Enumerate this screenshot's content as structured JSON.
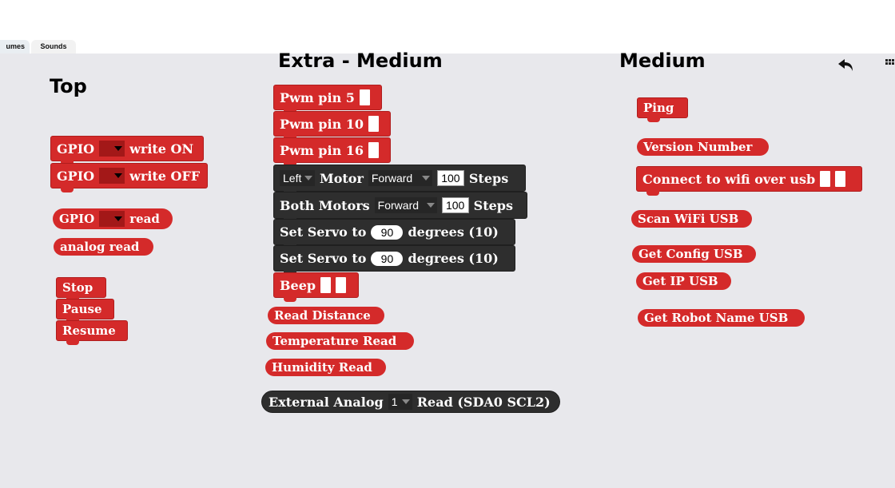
{
  "tabs": {
    "costumes": "umes",
    "sounds": "Sounds"
  },
  "headings": {
    "top": "Top",
    "extra_medium": "Extra - Medium",
    "medium": "Medium"
  },
  "top": {
    "gpio": "GPIO",
    "write_on": "write ON",
    "write_off": "write OFF",
    "read": "read",
    "analog_read": "analog read",
    "stop": "Stop",
    "pause": "Pause",
    "resume": "Resume"
  },
  "extra": {
    "pwm5": "Pwm pin 5",
    "pwm10": "Pwm pin 10",
    "pwm16": "Pwm pin 16",
    "left": "Left",
    "motor": "Motor",
    "forward": "Forward",
    "steps_value": "100",
    "steps": "Steps",
    "both_motors": "Both Motors",
    "set_servo": "Set Servo to",
    "servo_value": "90",
    "degrees": "degrees (10)",
    "beep": "Beep",
    "read_distance": "Read Distance",
    "temperature_read": "Temperature Read",
    "humidity_read": "Humidity Read",
    "external_analog": "External Analog",
    "analog_channel": "1",
    "read_sda": "Read (SDA0 SCL2)"
  },
  "medium": {
    "ping": "Ping",
    "version_number": "Version Number",
    "connect_wifi": "Connect to wifi over usb",
    "scan_wifi": "Scan WiFi USB",
    "get_config": "Get Config USB",
    "get_ip": "Get IP USB",
    "get_robot_name": "Get Robot Name USB"
  },
  "icons": {
    "undo": "undo-icon",
    "toolbar": "grid-icon"
  },
  "colors": {
    "block_red": "#d42a2a",
    "block_dark": "#2e2e2e",
    "workspace": "#e8e8ec"
  }
}
